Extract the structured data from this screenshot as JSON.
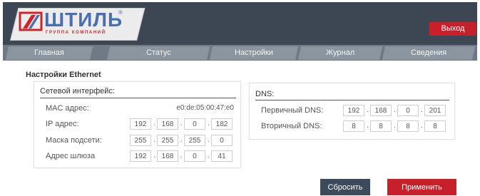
{
  "brand": {
    "name": "ШТИЛЬ",
    "subtitle": "ГРУППА КОМПАНИЙ",
    "registered": "®",
    "colors": {
      "word": "#4a6fb0",
      "accent": "#c9262d"
    }
  },
  "header": {
    "logout_label": "Выход"
  },
  "nav": {
    "tabs": [
      {
        "label": "Главная"
      },
      {
        "label": "Статус"
      },
      {
        "label": "Настройки"
      },
      {
        "label": "Журнал"
      },
      {
        "label": "Сведения"
      }
    ]
  },
  "page": {
    "title": "Настройки Ethernet"
  },
  "network": {
    "title": "Сетевой интерфейс:",
    "mac_label": "MAC адрес:",
    "mac_value": "e0:de:05:00:47:e0",
    "ip_label": "IP адрес:",
    "ip": [
      "192",
      "168",
      "0",
      "182"
    ],
    "mask_label": "Маска подсети:",
    "mask": [
      "255",
      "255",
      "255",
      "0"
    ],
    "gateway_label": "Адрес шлюза",
    "gateway": [
      "192",
      "168",
      "0",
      "41"
    ]
  },
  "dns": {
    "title": "DNS:",
    "primary_label": "Первичный DNS:",
    "primary": [
      "192",
      "168",
      "0",
      "201"
    ],
    "secondary_label": "Вторичный DNS:",
    "secondary": [
      "8",
      "8",
      "8",
      "8"
    ]
  },
  "actions": {
    "reset_label": "Сбросить",
    "apply_label": "Применить"
  },
  "colors": {
    "header_bg": "#3d4753",
    "nav_bg": "#6f7a86",
    "tab_bg": "#8b95a0",
    "danger": "#c8202a",
    "reset_bg": "#3c4a5c"
  }
}
